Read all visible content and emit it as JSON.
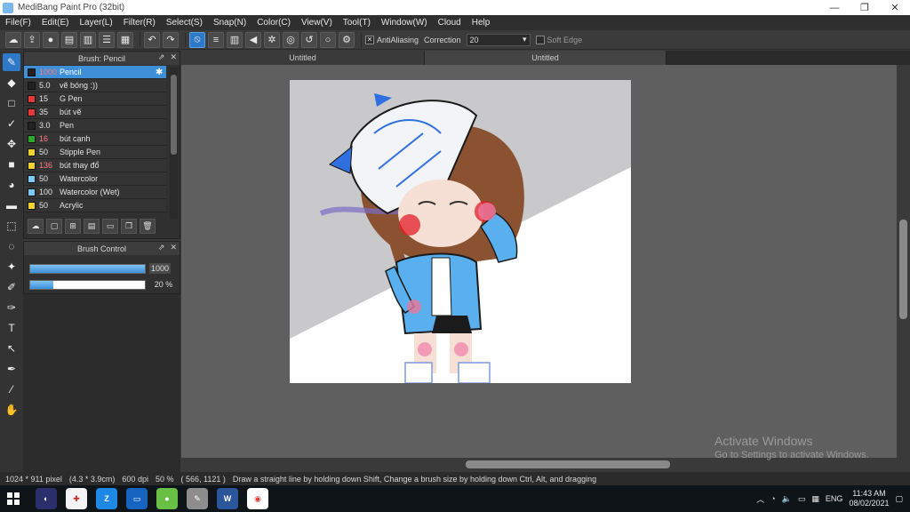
{
  "window": {
    "title": "MediBang Paint Pro (32bit)",
    "minimize": "—",
    "maximize": "❐",
    "close": "✕"
  },
  "menu": [
    "File(F)",
    "Edit(E)",
    "Layer(L)",
    "Filter(R)",
    "Select(S)",
    "Snap(N)",
    "Color(C)",
    "View(V)",
    "Tool(T)",
    "Window(W)",
    "Cloud",
    "Help"
  ],
  "toolbar": {
    "antialiasing_label": "AntiAliasing",
    "correction_label": "Correction",
    "correction_value": "20",
    "soft_edge_label": "Soft Edge"
  },
  "brush_panel": {
    "title": "Brush: Pencil",
    "items": [
      {
        "size": "1000",
        "name": "Pencil",
        "color": "#222222",
        "size_red": true,
        "selected": true
      },
      {
        "size": "5.0",
        "name": "vẽ bóng :))",
        "color": "#222222"
      },
      {
        "size": "15",
        "name": "G Pen",
        "color": "#e53935"
      },
      {
        "size": "35",
        "name": "bút vẽ",
        "color": "#e53935"
      },
      {
        "size": "3.0",
        "name": "Pen",
        "color": "#222222"
      },
      {
        "size": "16",
        "name": "bút cạnh",
        "color": "#2eaa2e",
        "size_red": true
      },
      {
        "size": "50",
        "name": "Stipple Pen",
        "color": "#f2d22e"
      },
      {
        "size": "136",
        "name": "bút thay đổ",
        "color": "#f2d22e",
        "size_red": true
      },
      {
        "size": "50",
        "name": "Watercolor",
        "color": "#7ccaf5"
      },
      {
        "size": "100",
        "name": "Watercolor (Wet)",
        "color": "#7ccaf5"
      },
      {
        "size": "50",
        "name": "Acrylic",
        "color": "#f2d22e"
      }
    ]
  },
  "brush_control": {
    "title": "Brush Control",
    "size_value": "1000",
    "size_fraction": 1.0,
    "opacity_value": "20 %",
    "opacity_fraction": 0.2
  },
  "tabs": [
    "Untitled",
    "Untitled"
  ],
  "activate_windows": {
    "title": "Activate Windows",
    "subtitle": "Go to Settings to activate Windows."
  },
  "status": {
    "image_size": "1024 * 911 pixel",
    "physical_size": "(4.3 * 3.9cm)",
    "dpi": "600 dpi",
    "zoom": "50 %",
    "cursor": "( 566, 1121 )",
    "hint": "Draw a straight line by holding down Shift, Change a brush size by holding down Ctrl, Alt, and dragging"
  },
  "taskbar": {
    "language": "ENG",
    "time": "11:43 AM",
    "date": "08/02/2021"
  }
}
